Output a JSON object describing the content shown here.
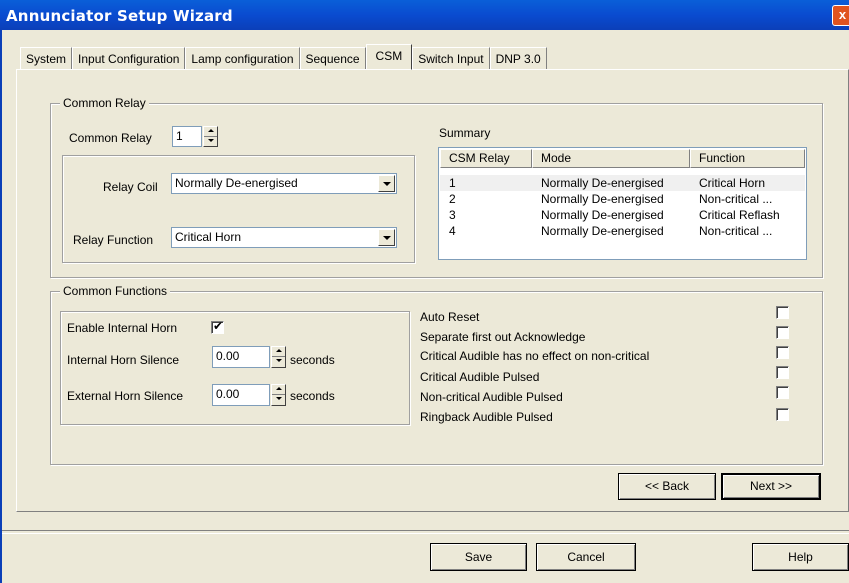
{
  "window": {
    "title": "Annunciator Setup Wizard",
    "close_glyph": "x"
  },
  "tabs": [
    {
      "label": "System"
    },
    {
      "label": "Input Configuration"
    },
    {
      "label": "Lamp configuration"
    },
    {
      "label": "Sequence"
    },
    {
      "label": "CSM"
    },
    {
      "label": "Switch Input"
    },
    {
      "label": "DNP 3.0"
    }
  ],
  "active_tab": "CSM",
  "common_relay": {
    "group_label": "Common Relay",
    "relay_label": "Common Relay",
    "relay_value": "1",
    "coil_label": "Relay Coil",
    "coil_value": "Normally De-energised",
    "function_label": "Relay Function",
    "function_value": "Critical Horn"
  },
  "summary": {
    "label": "Summary",
    "columns": [
      "CSM Relay",
      "Mode",
      "Function"
    ],
    "rows": [
      {
        "relay": "1",
        "mode": "Normally De-energised",
        "function": "Critical Horn"
      },
      {
        "relay": "2",
        "mode": "Normally De-energised",
        "function": "Non-critical ..."
      },
      {
        "relay": "3",
        "mode": "Normally De-energised",
        "function": "Critical Reflash"
      },
      {
        "relay": "4",
        "mode": "Normally De-energised",
        "function": "Non-critical ..."
      }
    ]
  },
  "common_functions": {
    "group_label": "Common Functions",
    "enable_horn_label": "Enable Internal Horn",
    "enable_horn_checked": true,
    "internal_silence_label": "Internal Horn Silence",
    "internal_silence_value": "0.00",
    "external_silence_label": "External Horn Silence",
    "external_silence_value": "0.00",
    "seconds_label": "seconds",
    "options": [
      {
        "label": "Auto Reset",
        "checked": false
      },
      {
        "label": "Separate first out Acknowledge",
        "checked": false
      },
      {
        "label": "Critical Audible has no effect on non-critical",
        "checked": false
      },
      {
        "label": "Critical Audible Pulsed",
        "checked": false
      },
      {
        "label": "Non-critical Audible Pulsed",
        "checked": false
      },
      {
        "label": "Ringback Audible Pulsed",
        "checked": false
      }
    ]
  },
  "nav": {
    "back_label": "<< Back",
    "next_label": "Next >>"
  },
  "footer": {
    "save_label": "Save",
    "cancel_label": "Cancel",
    "help_label": "Help"
  }
}
